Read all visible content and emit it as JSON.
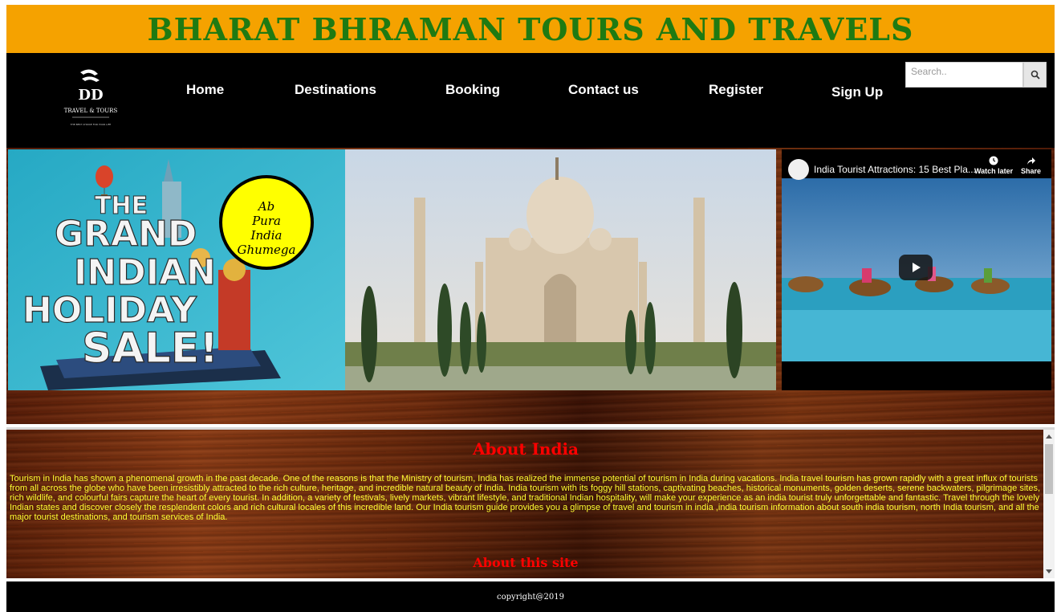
{
  "header": {
    "title": "BHARAT BHRAMAN TOURS AND TRAVELS"
  },
  "logo": {
    "line1": "DD",
    "line2": "TRAVEL & TOURS",
    "tagline": "THE BEST CHOICE FOR YOUR LIFE"
  },
  "nav": {
    "items": [
      {
        "label": "Home"
      },
      {
        "label": "Destinations"
      },
      {
        "label": "Booking"
      },
      {
        "label": "Contact us"
      },
      {
        "label": "Register"
      },
      {
        "label": "Sign Up"
      }
    ]
  },
  "search": {
    "placeholder": "Search.."
  },
  "banner": {
    "sale_text": [
      "THE",
      "GRAND",
      "INDIAN",
      "HOLIDAY",
      "SALE!"
    ],
    "badge_lines": [
      "Ab",
      "Pura",
      "India",
      "Ghumega"
    ]
  },
  "video": {
    "title": "India Tourist Attractions: 15 Best Pla...",
    "watch_later": "Watch later",
    "share": "Share"
  },
  "about": {
    "heading": "About India",
    "text": "Tourism in India has shown a phenomenal growth in the past decade. One of the reasons is that the Ministry of tourism, India has realized the immense potential of tourism in India during vacations. India travel tourism has grown rapidly with a great influx of tourists from all across the globe who have been irresistibly attracted to the rich culture, heritage, and incredible natural beauty of India. India tourism with its foggy hill stations, captivating beaches, historical monuments, golden deserts, serene backwaters, pilgrimage sites, rich wildlife, and colourful fairs capture the heart of every tourist. In addition, a variety of festivals, lively markets, vibrant lifestyle, and traditional Indian hospitality, will make your experience as an india tourist truly unforgettable and fantastic. Travel through the lovely Indian states and discover closely the resplendent colors and rich cultural locales of this incredible land. Our India tourism guide provides you a glimpse of travel and tourism in india ,india tourism information about south india tourism, north India tourism, and all the major tourist destinations, and tourism services of India.",
    "site_heading": "About this site"
  },
  "footer": {
    "copyright": "copyright@2019"
  },
  "colors": {
    "title_bar": "#f5a200",
    "title_text": "#1f7a12",
    "about_heading": "#ff0000",
    "about_text": "#ffff33"
  }
}
